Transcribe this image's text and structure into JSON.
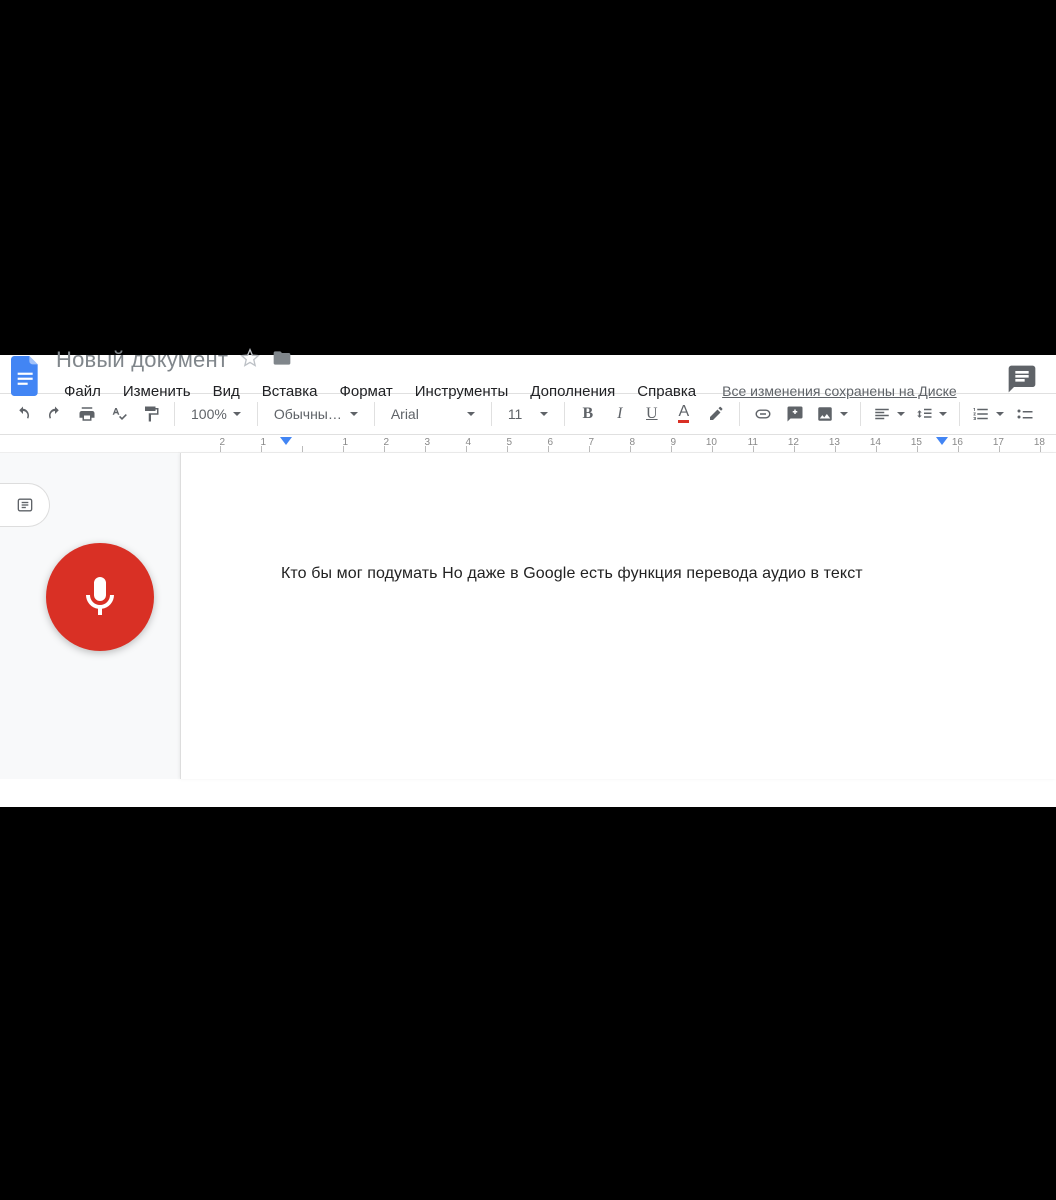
{
  "header": {
    "doc_title": "Новый документ",
    "save_status": "Все изменения сохранены на Диске"
  },
  "menu": {
    "items": [
      "Файл",
      "Изменить",
      "Вид",
      "Вставка",
      "Формат",
      "Инструменты",
      "Дополнения",
      "Справка"
    ]
  },
  "toolbar": {
    "zoom": "100%",
    "style": "Обычный …",
    "font": "Arial",
    "font_size": "11",
    "bold_label": "B",
    "italic_label": "I",
    "underline_label": "U",
    "textcolor_label": "A"
  },
  "ruler": {
    "labels": [
      "2",
      "1",
      "",
      "1",
      "2",
      "3",
      "4",
      "5",
      "6",
      "7",
      "8",
      "9",
      "10",
      "11",
      "12",
      "13",
      "14",
      "15",
      "16",
      "17",
      "18"
    ]
  },
  "document": {
    "body_text": "Кто бы мог подумать Но даже в Google есть функция перевода аудио в текст"
  }
}
